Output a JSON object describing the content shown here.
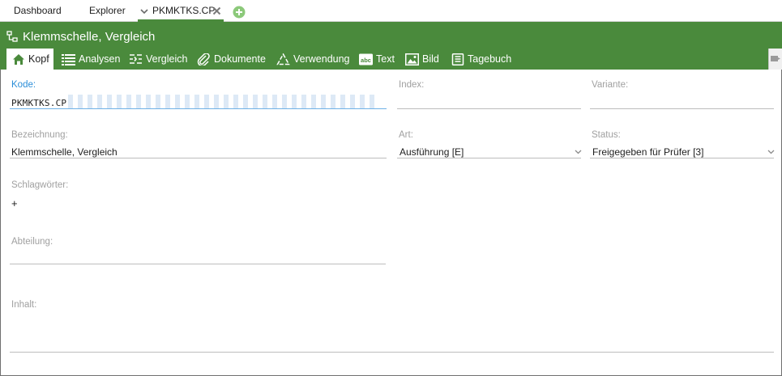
{
  "top_tabs": [
    {
      "label": "Dashboard"
    },
    {
      "label": "Explorer"
    },
    {
      "label": "PKMKTKS.CP",
      "active": true
    }
  ],
  "header": {
    "title": "Klemmschelle, Vergleich",
    "nav_tabs": [
      {
        "label": "Kopf",
        "icon": "home-icon",
        "active": true
      },
      {
        "label": "Analysen",
        "icon": "list-icon"
      },
      {
        "label": "Vergleich",
        "icon": "compare-icon"
      },
      {
        "label": "Dokumente",
        "icon": "paperclip-icon"
      },
      {
        "label": "Verwendung",
        "icon": "recycle-icon"
      },
      {
        "label": "Text",
        "icon": "abc-icon"
      },
      {
        "label": "Bild",
        "icon": "image-icon"
      },
      {
        "label": "Tagebuch",
        "icon": "journal-icon"
      }
    ]
  },
  "form": {
    "kode": {
      "label": "Kode:",
      "value": "PKMKTKS.CP"
    },
    "index": {
      "label": "Index:",
      "value": ""
    },
    "variante": {
      "label": "Variante:",
      "value": ""
    },
    "bezeichnung": {
      "label": "Bezeichnung:",
      "value": "Klemmschelle, Vergleich"
    },
    "art": {
      "label": "Art:",
      "value": "Ausführung [E]"
    },
    "status": {
      "label": "Status:",
      "value": "Freigegeben für Prüfer [3]"
    },
    "schlagwoerter": {
      "label": "Schlagwörter:",
      "add": "+"
    },
    "abteilung": {
      "label": "Abteilung:",
      "value": ""
    },
    "inhalt": {
      "label": "Inhalt:",
      "value": ""
    }
  },
  "colors": {
    "accent_green": "#4a8a3c",
    "focus_blue": "#2b8ed8",
    "label_gray": "#a0a0a0"
  }
}
